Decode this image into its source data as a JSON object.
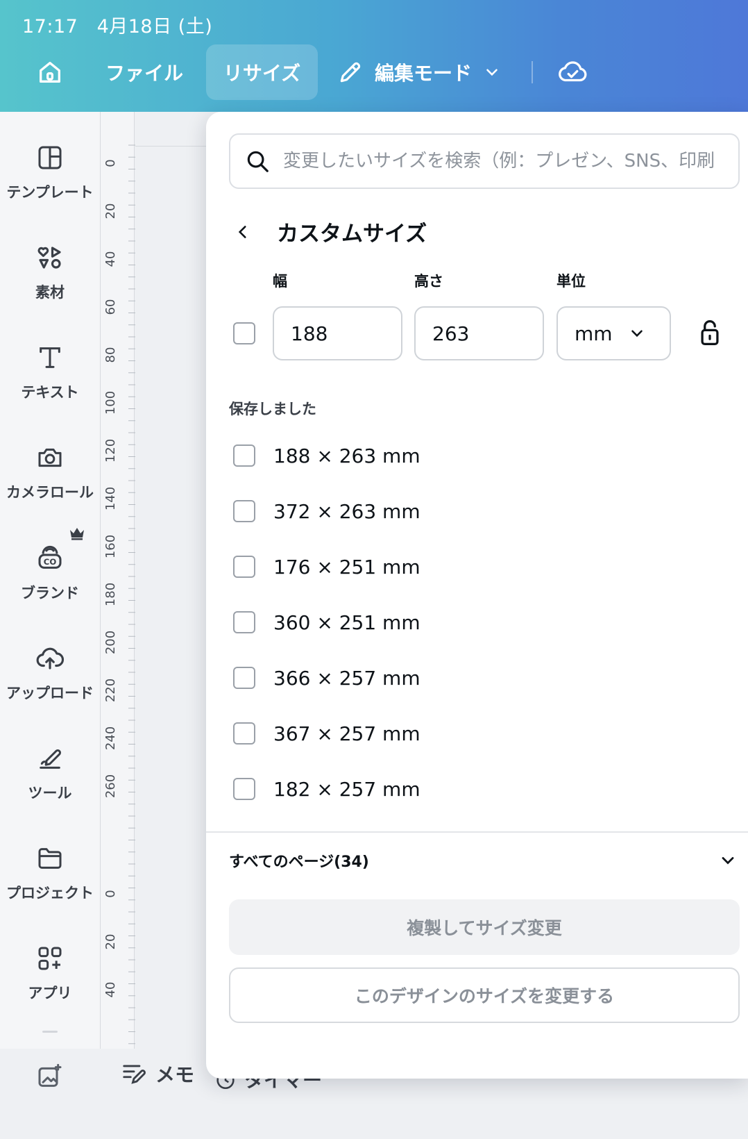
{
  "status": {
    "time": "17:17",
    "date": "4月18日 (土)"
  },
  "toolbar": {
    "file_label": "ファイル",
    "resize_label": "リサイズ",
    "edit_mode_label": "編集モード",
    "icons": [
      "home-icon",
      "pencil-icon",
      "chevron-down-icon",
      "cloud-check-icon"
    ]
  },
  "sidebar": {
    "items": [
      {
        "label": "テンプレート",
        "icon": "template-icon"
      },
      {
        "label": "素材",
        "icon": "elements-icon"
      },
      {
        "label": "テキスト",
        "icon": "text-icon"
      },
      {
        "label": "カメラロール",
        "icon": "camera-icon"
      },
      {
        "label": "ブランド",
        "icon": "brand-icon"
      },
      {
        "label": "アップロード",
        "icon": "upload-icon"
      },
      {
        "label": "ツール",
        "icon": "tools-icon"
      },
      {
        "label": "プロジェクト",
        "icon": "folder-icon"
      },
      {
        "label": "アプリ",
        "icon": "apps-icon"
      }
    ]
  },
  "ruler": {
    "labels": [
      "0",
      "20",
      "40",
      "60",
      "80",
      "100",
      "120",
      "140",
      "160",
      "180",
      "200",
      "220",
      "240",
      "260",
      "0",
      "20",
      "40"
    ]
  },
  "bottom": {
    "memo_label": "メモ",
    "timer_label": "タイマー"
  },
  "panel": {
    "search_placeholder": "変更したいサイズを検索（例：プレゼン、SNS、印刷",
    "title": "カスタムサイズ",
    "width_label": "幅",
    "height_label": "高さ",
    "unit_label": "単位",
    "width_value": "188",
    "height_value": "263",
    "unit_value": "mm",
    "saved_title": "保存しました",
    "saved_sizes": [
      "188 × 263 mm",
      "372 × 263 mm",
      "176 × 251 mm",
      "360 × 251 mm",
      "366 × 257 mm",
      "367 × 257 mm",
      "182 × 257 mm"
    ],
    "all_pages_label": "すべてのページ(34)",
    "duplicate_button": "複製してサイズ変更",
    "resize_button": "このデザインのサイズを変更する"
  },
  "colors": {
    "accent_start": "#56c4cc",
    "accent_end": "#4e78d8"
  }
}
